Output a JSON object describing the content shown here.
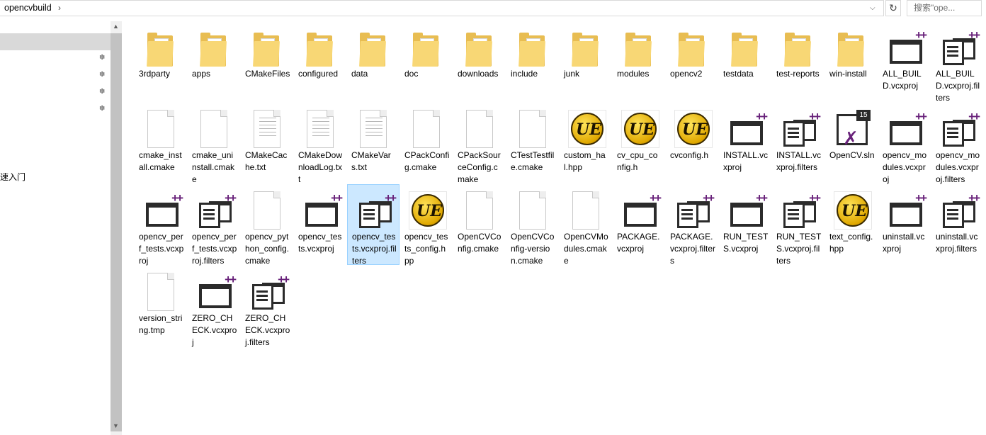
{
  "address": {
    "segment": "opencvbuild",
    "chevron": "›",
    "dropdown": "⌄"
  },
  "search": {
    "placeholder": "搜索\"ope..."
  },
  "nav": {
    "partial_label": "速入门"
  },
  "files": [
    {
      "name": "3rdparty",
      "type": "folder"
    },
    {
      "name": "apps",
      "type": "folder"
    },
    {
      "name": "CMakeFiles",
      "type": "folder"
    },
    {
      "name": "configured",
      "type": "folder"
    },
    {
      "name": "data",
      "type": "folder"
    },
    {
      "name": "doc",
      "type": "folder"
    },
    {
      "name": "downloads",
      "type": "folder"
    },
    {
      "name": "include",
      "type": "folder"
    },
    {
      "name": "junk",
      "type": "folder"
    },
    {
      "name": "modules",
      "type": "folder"
    },
    {
      "name": "opencv2",
      "type": "folder"
    },
    {
      "name": "testdata",
      "type": "folder"
    },
    {
      "name": "test-reports",
      "type": "folder"
    },
    {
      "name": "win-install",
      "type": "folder"
    },
    {
      "name": "ALL_BUILD.vcxproj",
      "type": "vcxproj"
    },
    {
      "name": "ALL_BUILD.vcxproj.filters",
      "type": "filters"
    },
    {
      "name": "cmake_install.cmake",
      "type": "blank"
    },
    {
      "name": "cmake_uninstall.cmake",
      "type": "blank"
    },
    {
      "name": "CMakeCache.txt",
      "type": "text"
    },
    {
      "name": "CMakeDownloadLog.txt",
      "type": "text"
    },
    {
      "name": "CMakeVars.txt",
      "type": "text"
    },
    {
      "name": "CPackConfig.cmake",
      "type": "blank"
    },
    {
      "name": "CPackSourceConfig.cmake",
      "type": "blank"
    },
    {
      "name": "CTestTestfile.cmake",
      "type": "blank"
    },
    {
      "name": "custom_hal.hpp",
      "type": "ue"
    },
    {
      "name": "cv_cpu_config.h",
      "type": "ue"
    },
    {
      "name": "cvconfig.h",
      "type": "ue"
    },
    {
      "name": "INSTALL.vcxproj",
      "type": "vcxproj"
    },
    {
      "name": "INSTALL.vcxproj.filters",
      "type": "filters"
    },
    {
      "name": "OpenCV.sln",
      "type": "sln"
    },
    {
      "name": "opencv_modules.vcxproj",
      "type": "vcxproj"
    },
    {
      "name": "opencv_modules.vcxproj.filters",
      "type": "filters"
    },
    {
      "name": "opencv_perf_tests.vcxproj",
      "type": "vcxproj"
    },
    {
      "name": "opencv_perf_tests.vcxproj.filters",
      "type": "filters"
    },
    {
      "name": "opencv_python_config.cmake",
      "type": "blank"
    },
    {
      "name": "opencv_tests.vcxproj",
      "type": "vcxproj"
    },
    {
      "name": "opencv_tests.vcxproj.filters",
      "type": "filters",
      "selected": true
    },
    {
      "name": "opencv_tests_config.hpp",
      "type": "ue"
    },
    {
      "name": "OpenCVConfig.cmake",
      "type": "blank"
    },
    {
      "name": "OpenCVConfig-version.cmake",
      "type": "blank"
    },
    {
      "name": "OpenCVModules.cmake",
      "type": "blank"
    },
    {
      "name": "PACKAGE.vcxproj",
      "type": "vcxproj"
    },
    {
      "name": "PACKAGE.vcxproj.filters",
      "type": "filters"
    },
    {
      "name": "RUN_TESTS.vcxproj",
      "type": "vcxproj"
    },
    {
      "name": "RUN_TESTS.vcxproj.filters",
      "type": "filters"
    },
    {
      "name": "text_config.hpp",
      "type": "ue"
    },
    {
      "name": "uninstall.vcxproj",
      "type": "vcxproj"
    },
    {
      "name": "uninstall.vcxproj.filters",
      "type": "filters"
    },
    {
      "name": "version_string.tmp",
      "type": "blank"
    },
    {
      "name": "ZERO_CHECK.vcxproj",
      "type": "vcxproj"
    },
    {
      "name": "ZERO_CHECK.vcxproj.filters",
      "type": "filters"
    }
  ],
  "icons": {
    "sln_version": "15",
    "ue_text": "UE",
    "pin": "📌"
  }
}
